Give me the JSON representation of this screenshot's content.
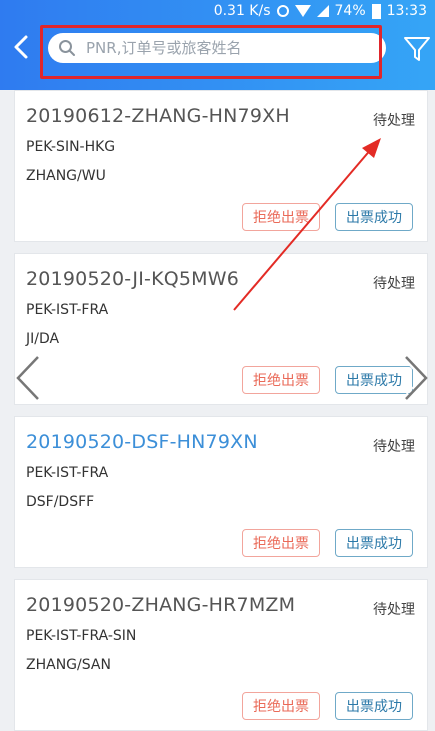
{
  "status_bar": {
    "speed": "0.31 K/s",
    "battery": "74%",
    "time": "13:33"
  },
  "search": {
    "placeholder": "PNR,订单号或旅客姓名"
  },
  "orders": [
    {
      "code": "20190612-ZHANG-HN79XH",
      "status": "待处理",
      "route": "PEK-SIN-HKG",
      "passenger": "ZHANG/WU",
      "reject_label": "拒绝出票",
      "issue_label": "出票成功"
    },
    {
      "code": "20190520-JI-KQ5MW6",
      "status": "待处理",
      "route": "PEK-IST-FRA",
      "passenger": "JI/DA",
      "reject_label": "拒绝出票",
      "issue_label": "出票成功"
    },
    {
      "code": "20190520-DSF-HN79XN",
      "status": "待处理",
      "route": "PEK-IST-FRA",
      "passenger": "DSF/DSFF",
      "reject_label": "拒绝出票",
      "issue_label": "出票成功"
    },
    {
      "code": "20190520-ZHANG-HR7MZM",
      "status": "待处理",
      "route": "PEK-IST-FRA-SIN",
      "passenger": "ZHANG/SAN",
      "reject_label": "拒绝出票",
      "issue_label": "出票成功"
    }
  ],
  "colors": {
    "header_start": "#2f7bf0",
    "header_end": "#35a5f6",
    "highlight_frame": "#e0262b",
    "link_code": "#3c8fd8"
  }
}
